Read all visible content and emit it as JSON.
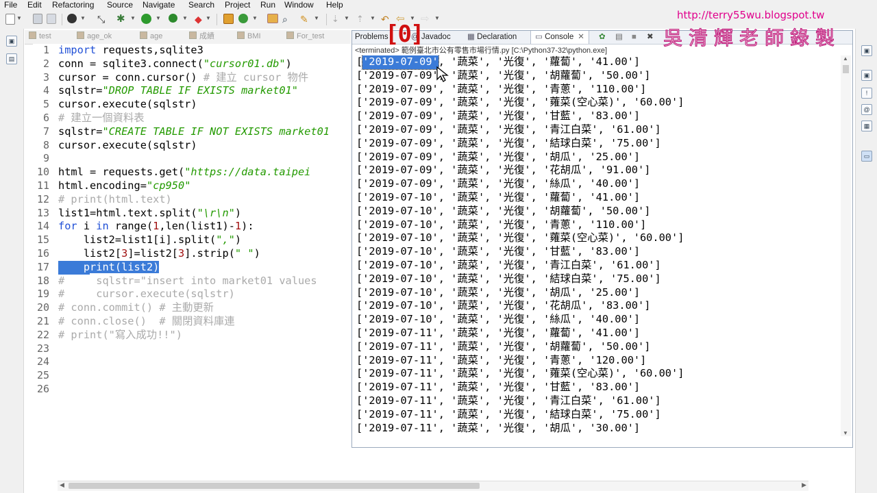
{
  "menu": [
    "File",
    "Edit",
    "Refactoring",
    "Source",
    "Navigate",
    "Search",
    "Project",
    "Run",
    "Window",
    "Help"
  ],
  "toolbar_icons": [
    "new-file-icon",
    "save-icon",
    "save-all-icon",
    "print-icon",
    "debug-icon",
    "run-icon",
    "external-tools-icon",
    "new-class-icon",
    "open-type-icon",
    "search-icon",
    "next-annotation-icon",
    "prev-annotation-icon",
    "back-icon",
    "forward-icon"
  ],
  "editor": {
    "tabs": [
      "test",
      "age_ok",
      "age",
      "成績",
      "BMI",
      "For_test"
    ],
    "line_numbers": [
      "1",
      "2",
      "3",
      "4",
      "5",
      "6",
      "7",
      "8",
      "9",
      "10",
      "11",
      "12",
      "13",
      "14",
      "15",
      "16",
      "17",
      "18",
      "19",
      "20",
      "21",
      "22",
      "23",
      "24",
      "25",
      "26"
    ]
  },
  "console": {
    "tabs": [
      "Problems",
      "Javadoc",
      "Declaration",
      "Console"
    ],
    "status": "<terminated> 範例臺北市公有零售市場行情.py [C:\\Python37-32\\python.exe]",
    "rows": [
      [
        "2019-07-09",
        "蔬菜",
        "光復",
        "蘿蔔",
        "41.00"
      ],
      [
        "2019-07-09",
        "蔬菜",
        "光復",
        "胡蘿蔔",
        "50.00"
      ],
      [
        "2019-07-09",
        "蔬菜",
        "光復",
        "青蔥",
        "110.00"
      ],
      [
        "2019-07-09",
        "蔬菜",
        "光復",
        "蕹菜(空心菜)",
        "60.00"
      ],
      [
        "2019-07-09",
        "蔬菜",
        "光復",
        "甘藍",
        "83.00"
      ],
      [
        "2019-07-09",
        "蔬菜",
        "光復",
        "青江白菜",
        "61.00"
      ],
      [
        "2019-07-09",
        "蔬菜",
        "光復",
        "結球白菜",
        "75.00"
      ],
      [
        "2019-07-09",
        "蔬菜",
        "光復",
        "胡瓜",
        "25.00"
      ],
      [
        "2019-07-09",
        "蔬菜",
        "光復",
        "花胡瓜",
        "91.00"
      ],
      [
        "2019-07-09",
        "蔬菜",
        "光復",
        "絲瓜",
        "40.00"
      ],
      [
        "2019-07-10",
        "蔬菜",
        "光復",
        "蘿蔔",
        "41.00"
      ],
      [
        "2019-07-10",
        "蔬菜",
        "光復",
        "胡蘿蔔",
        "50.00"
      ],
      [
        "2019-07-10",
        "蔬菜",
        "光復",
        "青蔥",
        "110.00"
      ],
      [
        "2019-07-10",
        "蔬菜",
        "光復",
        "蕹菜(空心菜)",
        "60.00"
      ],
      [
        "2019-07-10",
        "蔬菜",
        "光復",
        "甘藍",
        "83.00"
      ],
      [
        "2019-07-10",
        "蔬菜",
        "光復",
        "青江白菜",
        "61.00"
      ],
      [
        "2019-07-10",
        "蔬菜",
        "光復",
        "結球白菜",
        "75.00"
      ],
      [
        "2019-07-10",
        "蔬菜",
        "光復",
        "胡瓜",
        "25.00"
      ],
      [
        "2019-07-10",
        "蔬菜",
        "光復",
        "花胡瓜",
        "83.00"
      ],
      [
        "2019-07-10",
        "蔬菜",
        "光復",
        "絲瓜",
        "40.00"
      ],
      [
        "2019-07-11",
        "蔬菜",
        "光復",
        "蘿蔔",
        "41.00"
      ],
      [
        "2019-07-11",
        "蔬菜",
        "光復",
        "胡蘿蔔",
        "50.00"
      ],
      [
        "2019-07-11",
        "蔬菜",
        "光復",
        "青蔥",
        "120.00"
      ],
      [
        "2019-07-11",
        "蔬菜",
        "光復",
        "蕹菜(空心菜)",
        "60.00"
      ],
      [
        "2019-07-11",
        "蔬菜",
        "光復",
        "甘藍",
        "83.00"
      ],
      [
        "2019-07-11",
        "蔬菜",
        "光復",
        "青江白菜",
        "61.00"
      ],
      [
        "2019-07-11",
        "蔬菜",
        "光復",
        "結球白菜",
        "75.00"
      ],
      [
        "2019-07-11",
        "蔬菜",
        "光復",
        "胡瓜",
        "30.00"
      ]
    ]
  },
  "overlay": {
    "url": "http://terry55wu.blogspot.tw",
    "watermark": "吳清輝老師錄製",
    "annotation": "[0]"
  },
  "colors": {
    "selection": "#3b7bd8",
    "keyword": "#1f4fd6",
    "string": "#239a00",
    "comment": "#aaaaaa",
    "annotation": "#d01010",
    "watermark": "#e0008c"
  }
}
